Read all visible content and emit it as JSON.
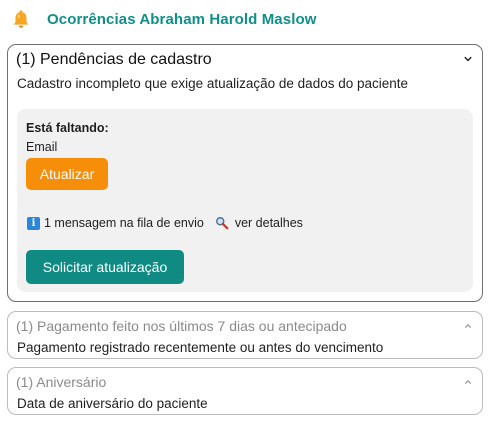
{
  "header": {
    "title": "Ocorrências Abraham Harold Maslow",
    "icon": "bell-icon",
    "title_color": "#0f8f89"
  },
  "cards": [
    {
      "title": "(1) Pendências de cadastro",
      "description": "Cadastro incompleto que exige atualização de dados do paciente",
      "expanded": true,
      "missing_label": "Está faltando:",
      "missing_value": "Email",
      "update_button": "Atualizar",
      "queue_text": "1 mensagem na fila de envio",
      "details_link": "ver detalhes",
      "request_button": "Solicitar atualização"
    },
    {
      "title": "(1) Pagamento feito nos últimos 7 dias ou antecipado",
      "description": "Pagamento registrado recentemente ou antes do vencimento",
      "expanded": false
    },
    {
      "title": "(1) Aniversário",
      "description": "Data de aniversário do paciente",
      "expanded": false
    }
  ],
  "colors": {
    "accent_teal": "#0f8b84",
    "update_orange": "#f78e0a",
    "info_blue": "#2b86d9"
  }
}
